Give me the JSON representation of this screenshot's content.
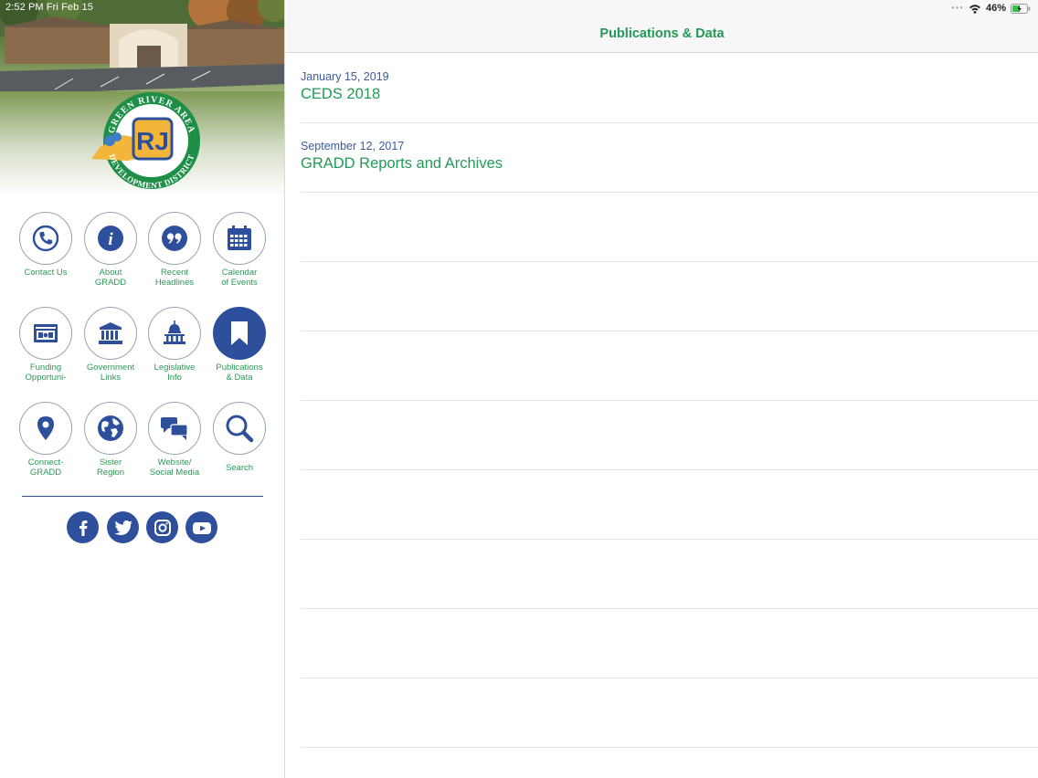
{
  "status_bar": {
    "time_date": "2:52 PM  Fri Feb 15",
    "battery": "46%"
  },
  "logo": {
    "text_top": "GREEN RIVER AREA",
    "text_bottom": "DEVELOPMENT DISTRICT"
  },
  "menu": [
    {
      "label": "Contact Us",
      "icon": "phone-icon"
    },
    {
      "label": "About\nGRADD",
      "icon": "info-icon"
    },
    {
      "label": "Recent\nHeadlines",
      "icon": "quote-icon"
    },
    {
      "label": "Calendar\nof Events",
      "icon": "calendar-icon"
    },
    {
      "label": "Funding\nOpportuni-",
      "icon": "money-icon"
    },
    {
      "label": "Government\nLinks",
      "icon": "bank-icon"
    },
    {
      "label": "Legislative\nInfo",
      "icon": "capitol-icon"
    },
    {
      "label": "Publications\n& Data",
      "icon": "bookmark-icon"
    },
    {
      "label": "Connect-\nGRADD",
      "icon": "map-pin-icon"
    },
    {
      "label": "Sister\nRegion",
      "icon": "globe-icon"
    },
    {
      "label": "Website/\nSocial Media",
      "icon": "chat-bubbles-icon"
    },
    {
      "label": "Search",
      "icon": "search-icon"
    }
  ],
  "social": [
    "facebook-icon",
    "twitter-icon",
    "instagram-icon",
    "youtube-icon"
  ],
  "main": {
    "title": "Publications & Data",
    "items": [
      {
        "date": "January 15, 2019",
        "title": "CEDS 2018"
      },
      {
        "date": "September 12, 2017",
        "title": "GRADD Reports and Archives"
      }
    ]
  },
  "colors": {
    "accent_green": "#239a55",
    "brand_blue": "#2d4f9c"
  }
}
